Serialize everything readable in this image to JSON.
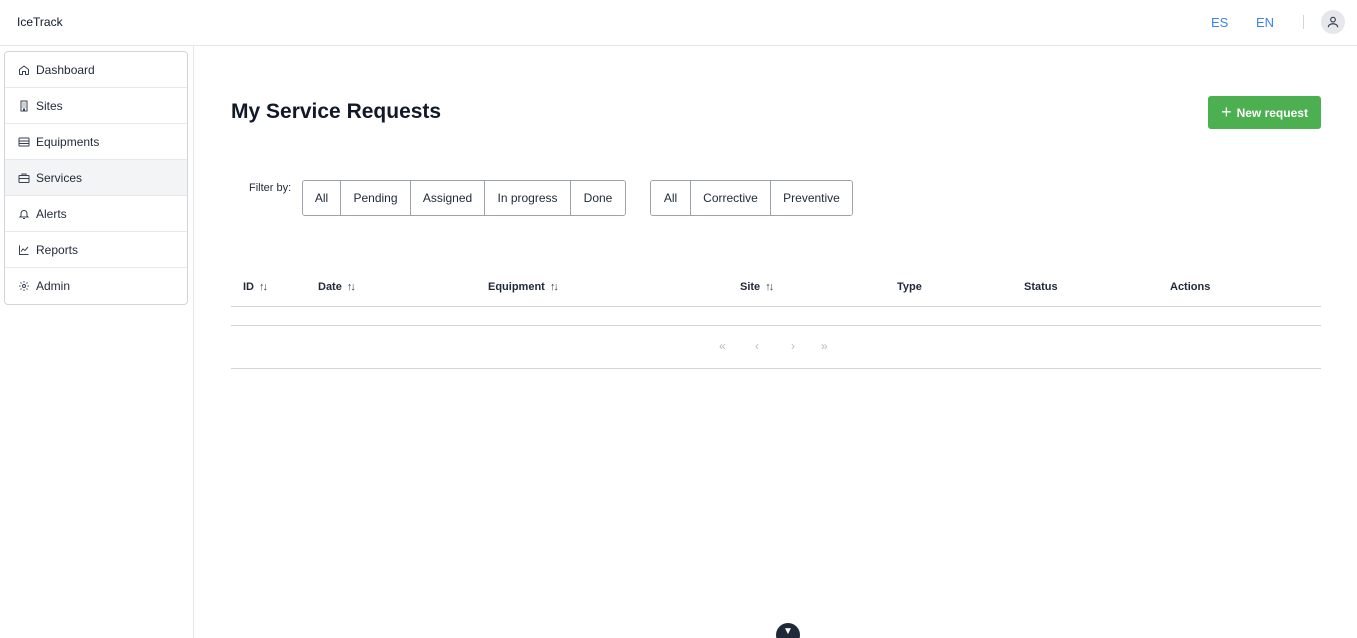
{
  "app": {
    "title": "IceTrack"
  },
  "header": {
    "languages": [
      "ES",
      "EN"
    ],
    "avatar_icon": "user-icon"
  },
  "sidebar": {
    "items": [
      {
        "label": "Dashboard",
        "icon": "home-icon"
      },
      {
        "label": "Sites",
        "icon": "building-icon"
      },
      {
        "label": "Equipments",
        "icon": "server-icon"
      },
      {
        "label": "Services",
        "icon": "briefcase-icon",
        "active": true
      },
      {
        "label": "Alerts",
        "icon": "bell-icon"
      },
      {
        "label": "Reports",
        "icon": "chart-line-icon"
      },
      {
        "label": "Admin",
        "icon": "gear-icon"
      }
    ]
  },
  "main": {
    "title": "My Service Requests",
    "new_request_label": "New request",
    "filter_label": "Filter by:",
    "status_filters": [
      "All",
      "Pending",
      "Assigned",
      "In progress",
      "Done"
    ],
    "type_filters": [
      "All",
      "Corrective",
      "Preventive"
    ],
    "table": {
      "columns": [
        "ID",
        "Date",
        "Equipment",
        "Site",
        "Type",
        "Status",
        "Actions"
      ],
      "sortable": [
        true,
        true,
        true,
        true,
        false,
        false,
        false
      ],
      "rows": []
    },
    "pagination": {
      "first": "«",
      "prev": "‹",
      "next": "›",
      "last": "»"
    }
  },
  "colors": {
    "accent": "#4caf50",
    "link": "#3b82f6"
  }
}
